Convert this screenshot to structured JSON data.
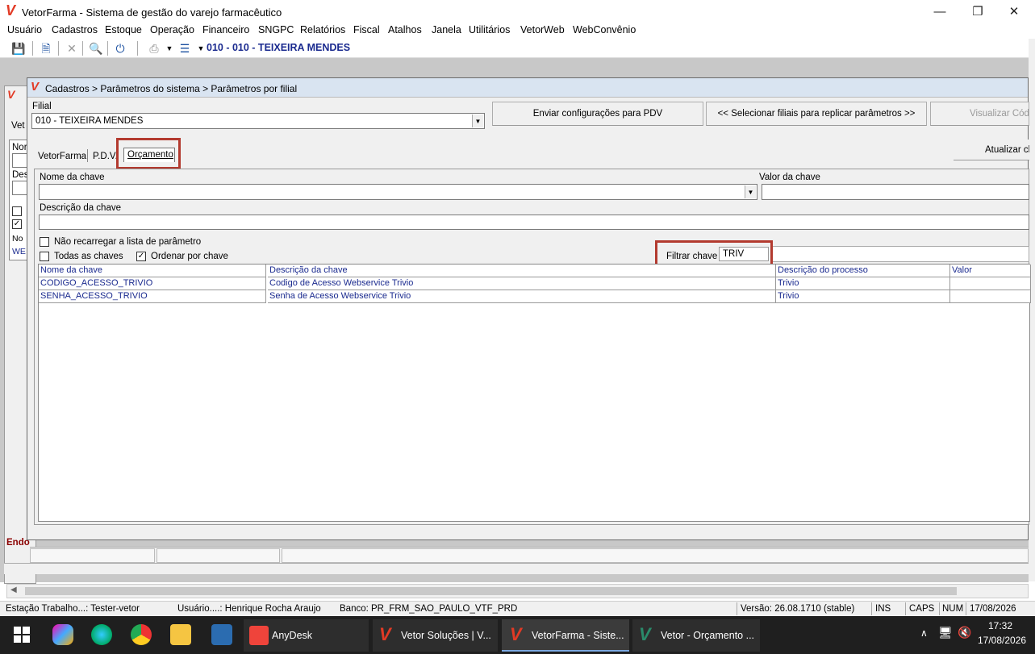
{
  "window": {
    "title": "VetorFarma - Sistema de gestão do varejo farmacêutico",
    "minimize": "—",
    "restore": "❐",
    "close": "✕"
  },
  "menu": [
    "Usuário",
    "Cadastros",
    "Estoque",
    "Operação",
    "Financeiro",
    "SNGPC",
    "Relatórios",
    "Fiscal",
    "Atalhos",
    "Janela",
    "Utilitários",
    "VetorWeb",
    "WebConvênio"
  ],
  "toolbar": {
    "store": "010 - 010 - TEIXEIRA MENDES"
  },
  "background_form": {
    "label_vet": "Vet",
    "label_nor": "Nor",
    "label_des": "Des",
    "label_no": "No",
    "label_we": "WE",
    "label_end": "Endo"
  },
  "dialog": {
    "breadcrumb": "Cadastros > Parâmetros do sistema > Parâmetros por filial",
    "filial_label": "Filial",
    "filial_value": "010 - TEIXEIRA MENDES",
    "btn_pdv": "Enviar configurações para  PDV",
    "btn_replicar": "<< Selecionar filiais para replicar parâmetros >>",
    "btn_visualizar": "Visualizar Códig",
    "btn_atualizar": "Atualizar cl",
    "tabs": [
      "VetorFarma",
      "P.D.V.",
      "Orçamento"
    ],
    "nome_chave_label": "Nome da chave",
    "valor_chave_label": "Valor da chave",
    "descricao_chave_label": "Descrição da chave",
    "nao_recarregar": "Não recarregar a lista de parâmetro",
    "todas_chaves": "Todas as chaves",
    "ordenar_chave": "Ordenar por chave",
    "filtrar_label": "Filtrar chave",
    "filtrar_value": "TRIV",
    "grid": {
      "headers": [
        "Nome da chave",
        "Descrição  da chave",
        "Descrição do processo",
        "Valor"
      ],
      "rows": [
        [
          "CODIGO_ACESSO_TRIVIO",
          "Codigo de Acesso Webservice Trivio",
          "Trivio",
          ""
        ],
        [
          "SENHA_ACESSO_TRIVIO",
          "Senha de Acesso Webservice Trivio",
          "Trivio",
          ""
        ]
      ]
    }
  },
  "statusbar": {
    "estacao": "Estação Trabalho...: Tester-vetor",
    "usuario": "Usuário....: Henrique Rocha Araujo",
    "banco": "Banco: PR_FRM_SAO_PAULO_VTF_PRD",
    "versao": "Versão: 26.08.1710 (stable)",
    "ins": "INS",
    "caps": "CAPS",
    "num": "NUM",
    "date": "17/08/2026"
  },
  "taskbar": {
    "anydesk": "AnyDesk",
    "vetor_solucoes": "Vetor Soluções  |  V...",
    "vetorfarma": "VetorFarma - Siste...",
    "vetor_orcamento": "Vetor - Orçamento ...",
    "time": "17:32",
    "date": "17/08/2026"
  }
}
